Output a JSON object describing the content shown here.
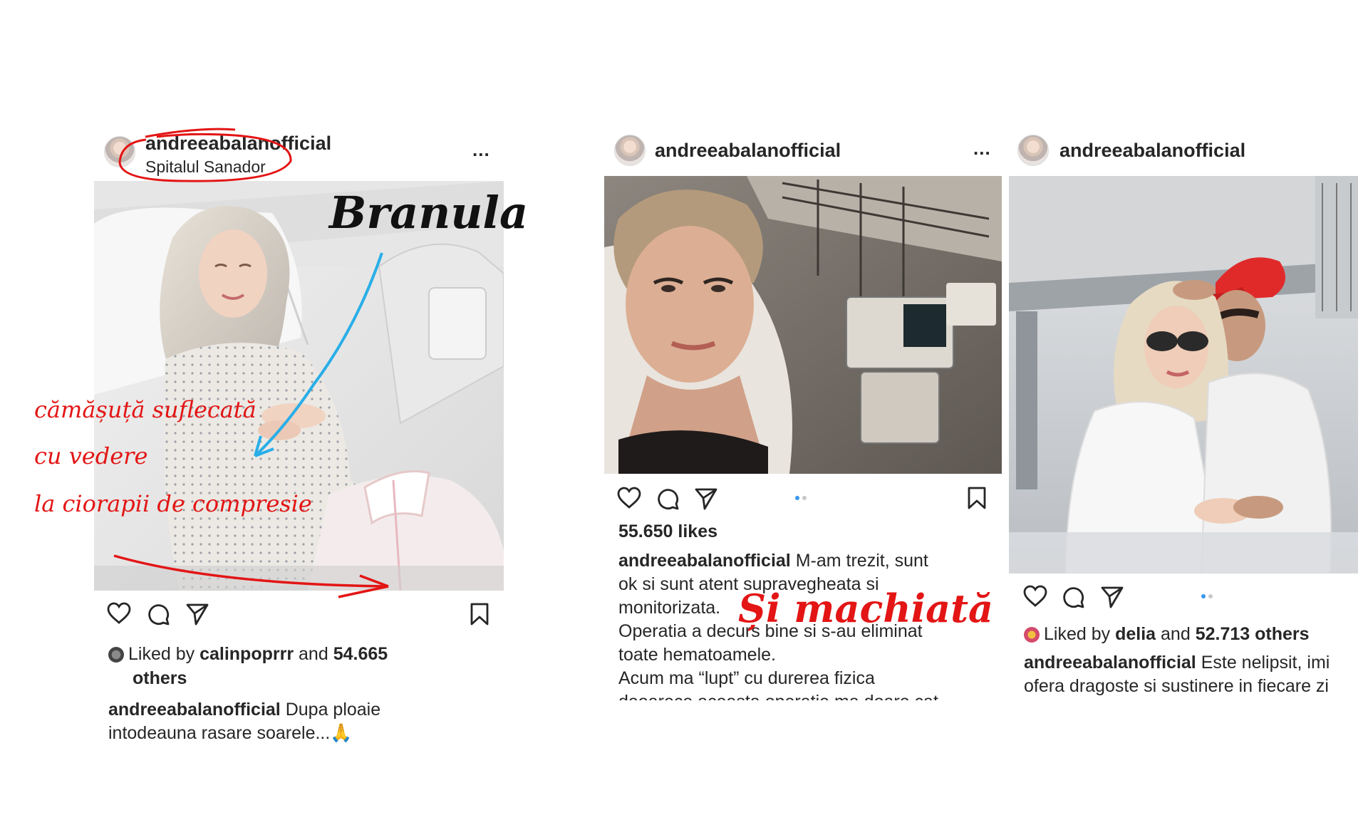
{
  "posts": [
    {
      "username": "andreeabalanofficial",
      "location": "Spitalul Sanador",
      "more": "...",
      "liked_by_prefix": "Liked by",
      "liked_by_user": "calinpoprrr",
      "liked_by_and": "and",
      "liked_by_count": "54.665",
      "liked_by_others": "others",
      "caption_user": "andreeabalanofficial",
      "caption_text_1": "Dupa ploaie",
      "caption_text_2": "intodeauna rasare soarele...🙏"
    },
    {
      "username": "andreeabalanofficial",
      "more": "...",
      "likes": "55.650 likes",
      "caption_user": "andreeabalanofficial",
      "caption_text_1": "M-am trezit, sunt",
      "caption_text_2": "ok si sunt atent supravegheata si",
      "caption_text_3": "monitorizata.",
      "caption_text_4": "Operatia a decurs bine si s-au eliminat",
      "caption_text_5": "toate hematoamele.",
      "caption_text_6": "Acum ma “lupt” cu durerea fizica",
      "caption_text_7": "deoarece aceasta operatie ma doare cat"
    },
    {
      "username": "andreeabalanofficial",
      "liked_by_prefix": "Liked by",
      "liked_by_user": "delia",
      "liked_by_and": "and",
      "liked_by_count": "52.713 others",
      "caption_user": "andreeabalanofficial",
      "caption_text_1": "Este nelipsit, imi",
      "caption_text_2": "ofera dragoste si sustinere in fiecare zi"
    }
  ],
  "annotations": {
    "branula": "Branula",
    "camasuta_1": "cămășuță suflecată",
    "camasuta_2": "cu vedere",
    "camasuta_3": "la ciorapii de compresie",
    "machiata": "Și machiată"
  },
  "colors": {
    "annotation_red": "#e31515",
    "annotation_blue": "#29aee8",
    "dot_active": "#3897f0",
    "text": "#262626"
  }
}
